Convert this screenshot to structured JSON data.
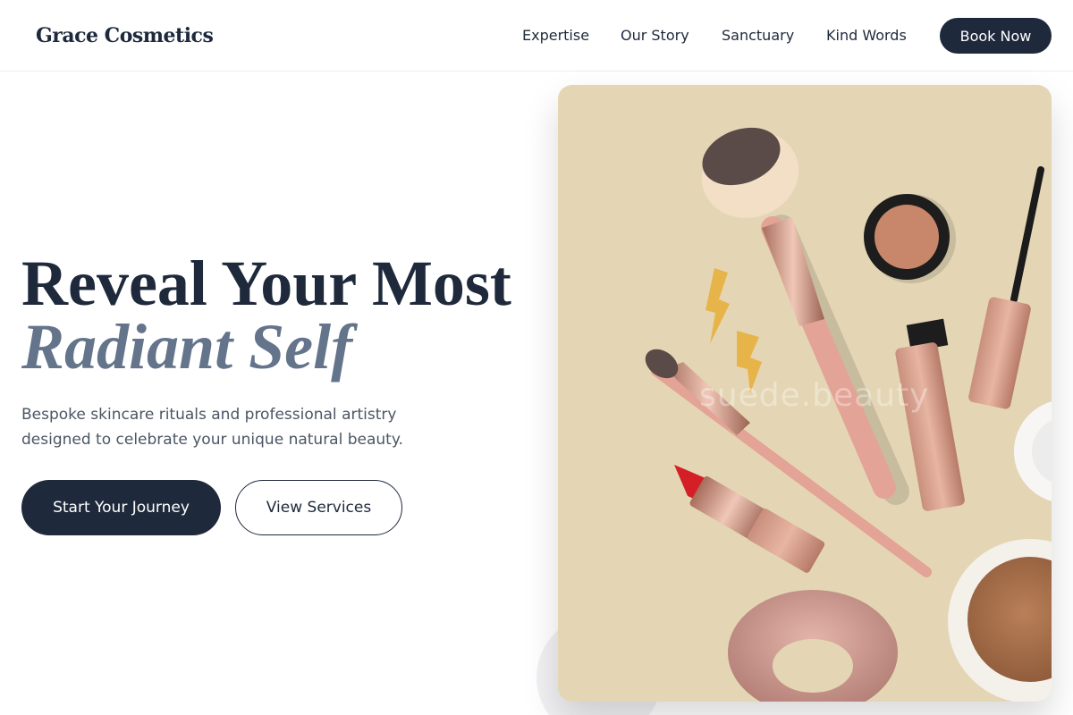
{
  "header": {
    "brand": "Grace Cosmetics",
    "nav": [
      "Expertise",
      "Our Story",
      "Sanctuary",
      "Kind Words"
    ],
    "cta": "Book Now"
  },
  "hero": {
    "title_line1": "Reveal Your Most",
    "title_line2": "Radiant Self",
    "subtitle_line1": "Bespoke skincare rituals and professional artistry",
    "subtitle_line2": "designed to celebrate your unique natural beauty.",
    "primary_button": "Start Your Journey",
    "secondary_button": "View Services"
  },
  "image": {
    "watermark": "suede.beauty"
  },
  "colors": {
    "primary": "#1e293b",
    "muted_heading": "#64748b",
    "body_text": "#4b5563",
    "image_background": "#e4d6b4"
  }
}
